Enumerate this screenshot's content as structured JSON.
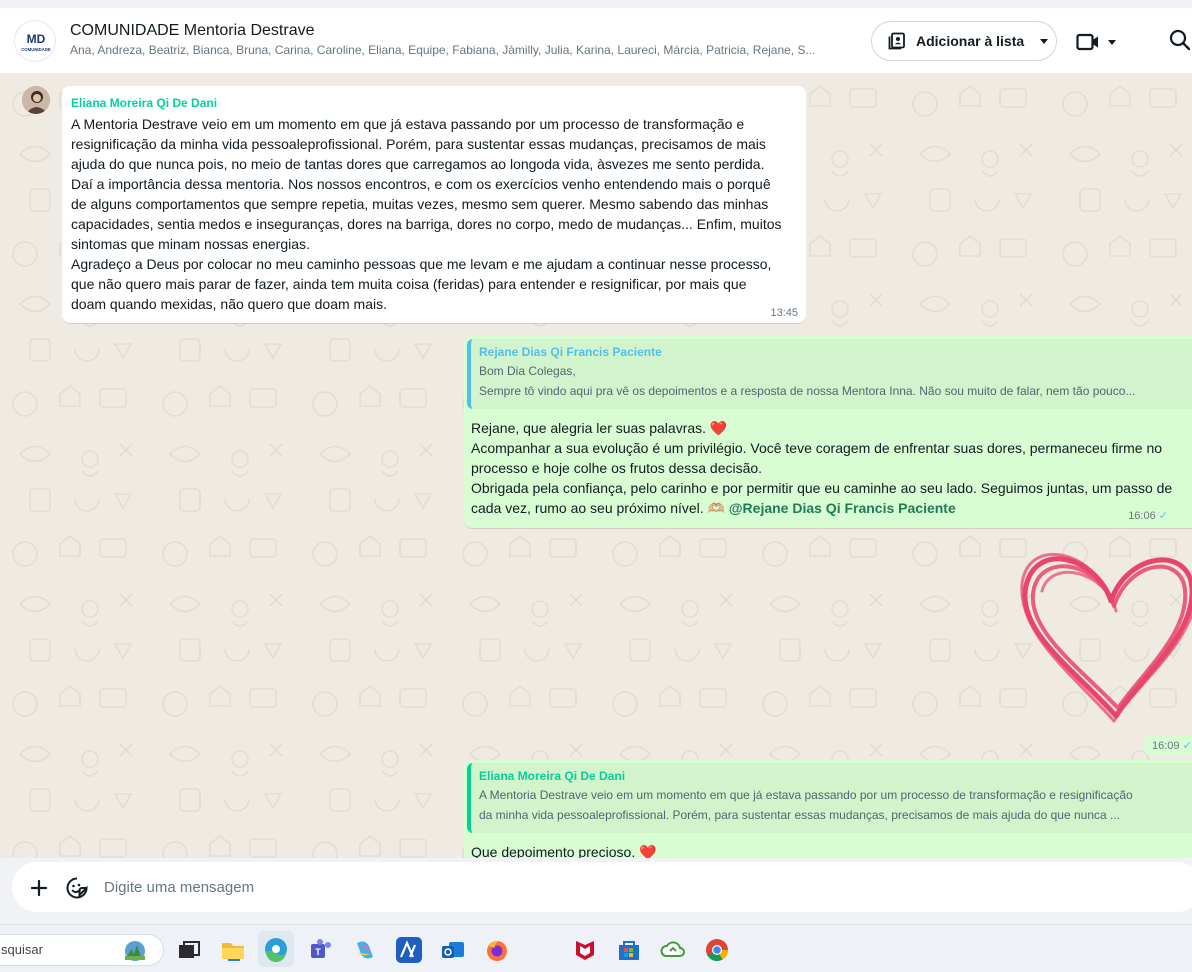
{
  "header": {
    "group_logo_text": "MD",
    "group_logo_sub": "COMUNIDADE",
    "title": "COMUNIDADE Mentoria Destrave",
    "members": "Ana, Andreza, Beatriz, Bianca, Bruna, Carina, Caroline, Eliana, Equipe, Fabiana, Jàmilly, Julia, Karina, Laureci, Márcia, Patricia, Rejane, S...",
    "add_list_label": "Adicionar à lista"
  },
  "messages": {
    "m1": {
      "sender": "Eliana Moreira Qi De Dani",
      "text": "A Mentoria Destrave veio em um momento em que já estava passando por um processo de transformação e\nresignificação da minha  vida pessoaleprofissional. Porém, para sustentar essas mudanças, precisamos de mais\najuda do que nunca pois, no meio de tantas dores que carregamos ao longoda vida, àsvezes me sento perdida.\nDaí a importância dessa mentoria. Nos nossos encontros, e com os exercícios venho entendendo mais o porquê\nde alguns comportamentos que sempre repetia, muitas vezes, mesmo sem querer. Mesmo sabendo das minhas\ncapacidades, sentia medos e inseguranças, dores na barriga, dores no corpo, medo de mudanças... Enfim, muitos\nsintomas que minam nossas energias.\nAgradeço a Deus por colocar no meu caminho pessoas que me levam e  me ajudam a continuar nesse processo,\nque não quero mais parar de  fazer, ainda tem muita coisa (feridas) para entender e resignificar, por mais que\ndoam quando mexidas, não quero que doam mais.",
      "time": "13:45"
    },
    "m2": {
      "quote_sender": "Rejane Dias Qi Francis Paciente",
      "quote_line1": "Bom Dia Colegas,",
      "quote_line2": "Sempre tô vindo aqui pra vê os depoimentos e a resposta  de nossa Mentora Inna. Não sou muito de falar, nem tão pouco...",
      "text": "Rejane, que alegria ler suas palavras. ❤️\nAcompanhar a sua evolução é um privilégio. Você teve coragem de enfrentar suas dores, permaneceu firme no\nprocesso e hoje colhe os frutos dessa decisão.\nObrigada pela confiança, pelo carinho e por permitir que eu caminhe ao seu lado. Seguimos juntas, um passo de\ncada vez, rumo ao seu próximo nível. 🫶🏼 ",
      "mention": "@Rejane Dias Qi Francis Paciente",
      "time": "16:06",
      "status": "✓"
    },
    "m3": {
      "sticker": "heart-sticker",
      "time": "16:09",
      "status": "✓"
    },
    "m4": {
      "quote_sender": "Eliana Moreira Qi De Dani",
      "quote_line1": "A Mentoria Destrave veio em um momento em que já estava passando por um processo de transformação e resignificação",
      "quote_line2": "da minha  vida pessoaleprofissional. Porém, para sustentar essas mudanças, precisamos de mais ajuda do que nunca ...",
      "text": "Que depoimento precioso. ❤️"
    }
  },
  "composer": {
    "placeholder": "Digite uma mensagem"
  },
  "taskbar": {
    "search_text": "squisar"
  },
  "colors": {
    "chat_bg": "#efeae2",
    "outgoing_bubble": "#d9fdd3",
    "sender_green": "#06cf9c",
    "quote_blue": "#53bdeb",
    "heart_pink": "#e8456b"
  }
}
